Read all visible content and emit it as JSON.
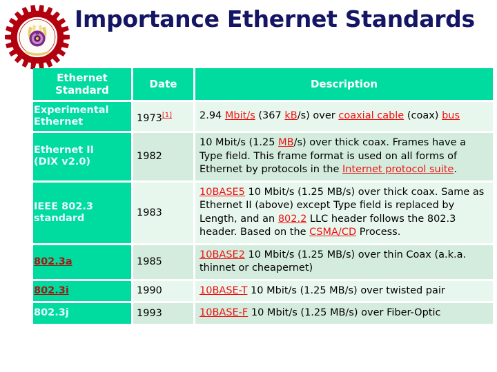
{
  "title": "Importance Ethernet Standards",
  "logo": {
    "name": "college-gear-emblem",
    "alt": "Institution gear emblem logo"
  },
  "colors": {
    "title_navy": "#151565",
    "header_teal": "#00dba0",
    "row_light": "#e8f7ee",
    "row_dark": "#d4ecdd",
    "link_red": "#ee1111",
    "link_dark_red": "#9e1a13",
    "logo_red": "#b3000f"
  },
  "table": {
    "headers": {
      "standard": "Ethernet Standard",
      "standard_line1": "Ethernet",
      "standard_line2": "Standard",
      "date": "Date",
      "description": "Description"
    },
    "rows": [
      {
        "standard": "Experimental Ethernet",
        "standard_line1": "Experimental",
        "standard_line2": "Ethernet",
        "standard_is_link": false,
        "date": "1973",
        "date_superscript": "[1]",
        "description_plain": "2.94 Mbit/s (367 kB/s) over coaxial cable (coax) bus",
        "description_parts": [
          {
            "t": "2.94 ",
            "link": false
          },
          {
            "t": "Mbit/s",
            "link": true
          },
          {
            "t": " (367 ",
            "link": false
          },
          {
            "t": "kB",
            "link": true
          },
          {
            "t": "/s) over ",
            "link": false
          },
          {
            "t": "coaxial cable",
            "link": true
          },
          {
            "t": " (coax) ",
            "link": false
          },
          {
            "t": "bus",
            "link": true
          }
        ]
      },
      {
        "standard": "Ethernet II (DIX v2.0)",
        "standard_line1": "Ethernet II",
        "standard_line2": "(DIX v2.0)",
        "standard_is_link": false,
        "date": "1982",
        "date_superscript": "",
        "description_plain": "10 Mbit/s (1.25 MB/s) over thick coax. Frames have a Type field. This frame format is used on all forms of Ethernet by protocols in the Internet protocol suite.",
        "description_parts": [
          {
            "t": "10 Mbit/s (1.25 ",
            "link": false
          },
          {
            "t": "MB",
            "link": true
          },
          {
            "t": "/s) over thick coax. Frames have a Type field. This frame format is used on all forms of Ethernet by protocols in the ",
            "link": false
          },
          {
            "t": "Internet protocol suite",
            "link": true
          },
          {
            "t": ".",
            "link": false
          }
        ]
      },
      {
        "standard": "IEEE 802.3 standard",
        "standard_line1": "IEEE 802.3",
        "standard_line2": "standard",
        "standard_is_link": false,
        "date": "1983",
        "date_superscript": "",
        "description_plain": "10BASE5 10 Mbit/s (1.25 MB/s) over thick coax. Same as Ethernet II (above) except Type field is replaced by Length, and an 802.2 LLC header follows the 802.3 header. Based on the CSMA/CD Process.",
        "description_parts": [
          {
            "t": "10BASE5",
            "link": true
          },
          {
            "t": " 10 Mbit/s (1.25 MB/s) over thick coax. Same as Ethernet II (above) except Type field is replaced by Length, and an ",
            "link": false
          },
          {
            "t": "802.2",
            "link": true
          },
          {
            "t": " LLC header follows the 802.3 header. Based on the ",
            "link": false
          },
          {
            "t": "CSMA/CD",
            "link": true
          },
          {
            "t": " Process.",
            "link": false
          }
        ]
      },
      {
        "standard": "802.3a",
        "standard_line1": "802.3a",
        "standard_line2": "",
        "standard_is_link": true,
        "date": "1985",
        "date_superscript": "",
        "description_plain": "10BASE2 10 Mbit/s (1.25 MB/s) over thin Coax (a.k.a. thinnet or cheapernet)",
        "description_parts": [
          {
            "t": "10BASE2",
            "link": true
          },
          {
            "t": " 10 Mbit/s (1.25 MB/s) over thin Coax (a.k.a. thinnet or cheapernet)",
            "link": false
          }
        ]
      },
      {
        "standard": "802.3i",
        "standard_line1": "802.3i",
        "standard_line2": "",
        "standard_is_link": true,
        "date": "1990",
        "date_superscript": "",
        "description_plain": "10BASE-T 10 Mbit/s (1.25 MB/s) over twisted pair",
        "description_parts": [
          {
            "t": "10BASE-T",
            "link": true
          },
          {
            "t": " 10 Mbit/s (1.25 MB/s) over twisted pair",
            "link": false
          }
        ]
      },
      {
        "standard": "802.3j",
        "standard_line1": "802.3j",
        "standard_line2": "",
        "standard_is_link": false,
        "date": "1993",
        "date_superscript": "",
        "description_plain": "10BASE-F 10 Mbit/s (1.25 MB/s) over Fiber-Optic",
        "description_parts": [
          {
            "t": "10BASE-F",
            "link": true
          },
          {
            "t": " 10 Mbit/s (1.25 MB/s) over Fiber-Optic",
            "link": false
          }
        ]
      }
    ]
  }
}
